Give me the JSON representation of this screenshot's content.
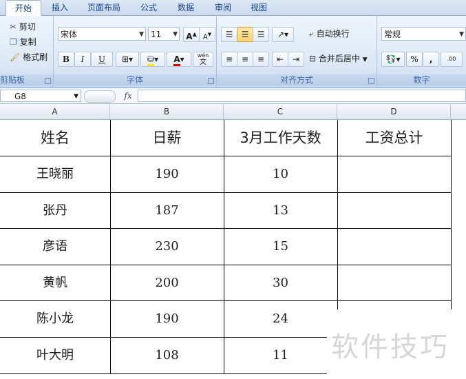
{
  "tabs": [
    "开始",
    "插入",
    "页面布局",
    "公式",
    "数据",
    "审阅",
    "视图"
  ],
  "ribbon": {
    "clipboard": {
      "cut": "剪切",
      "copy": "复制",
      "format_painter": "格式刷",
      "label": "剪贴板"
    },
    "font": {
      "name": "宋体",
      "size": "11",
      "grow": "A",
      "shrink": "A",
      "bold": "B",
      "italic": "I",
      "underline": "U",
      "font_color": "A",
      "phonetic": "wén",
      "label": "字体"
    },
    "alignment": {
      "wrap_text": "自动换行",
      "merge_center": "合并后居中",
      "label": "对齐方式"
    },
    "number": {
      "format": "常规",
      "percent": "%",
      "comma": ",",
      "inc_decimal": ".00",
      "label": "数字"
    }
  },
  "formula_bar": {
    "cell_ref": "G8",
    "fx": "fx",
    "value": ""
  },
  "columns": [
    "A",
    "B",
    "C",
    "D"
  ],
  "table": {
    "headers": [
      "姓名",
      "日薪",
      "3月工作天数",
      "工资总计"
    ],
    "rows": [
      [
        "王晓丽",
        "190",
        "10",
        ""
      ],
      [
        "张丹",
        "187",
        "13",
        ""
      ],
      [
        "彦语",
        "230",
        "15",
        ""
      ],
      [
        "黄帆",
        "200",
        "30",
        ""
      ],
      [
        "陈小龙",
        "190",
        "24",
        ""
      ],
      [
        "叶大明",
        "108",
        "11",
        ""
      ]
    ]
  },
  "watermark": "软件技巧"
}
